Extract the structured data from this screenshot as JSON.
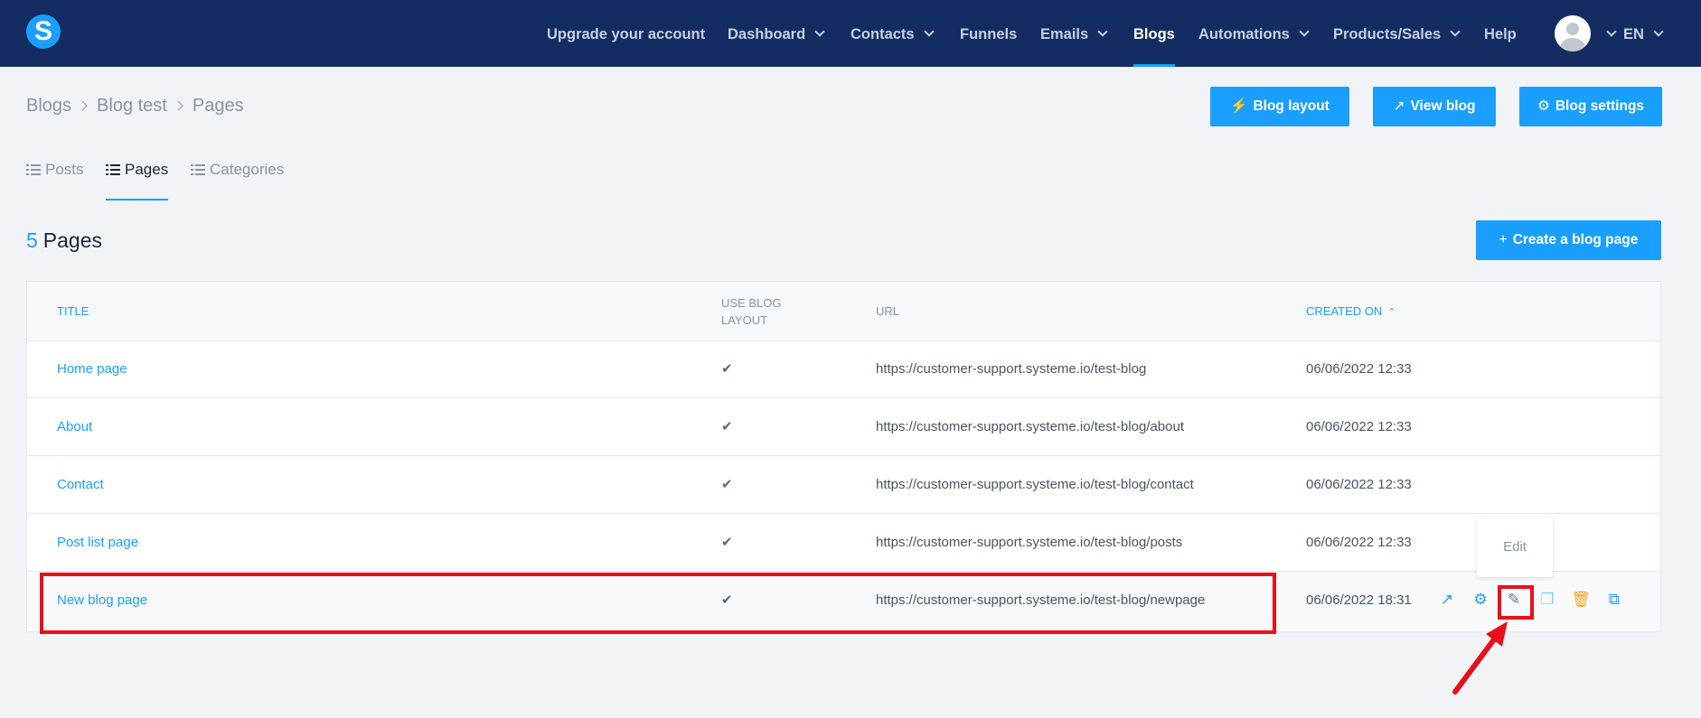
{
  "nav": {
    "items": [
      {
        "label": "Upgrade your account",
        "dropdown": false
      },
      {
        "label": "Dashboard",
        "dropdown": true
      },
      {
        "label": "Contacts",
        "dropdown": true
      },
      {
        "label": "Funnels",
        "dropdown": false
      },
      {
        "label": "Emails",
        "dropdown": true
      },
      {
        "label": "Blogs",
        "dropdown": false,
        "active": true
      },
      {
        "label": "Automations",
        "dropdown": true
      },
      {
        "label": "Products/Sales",
        "dropdown": true
      },
      {
        "label": "Help",
        "dropdown": false
      }
    ],
    "language": "EN",
    "logo_letter": "S"
  },
  "breadcrumb": [
    "Blogs",
    "Blog test",
    "Pages"
  ],
  "actions": {
    "blog_layout": "Blog layout",
    "view_blog": "View blog",
    "blog_settings": "Blog settings"
  },
  "tabs": [
    {
      "label": "Posts"
    },
    {
      "label": "Pages",
      "active": true
    },
    {
      "label": "Categories"
    }
  ],
  "summary": {
    "count": "5",
    "label": "Pages"
  },
  "create_button": "Create a blog page",
  "table": {
    "headers": {
      "title": "Title",
      "use_blog_line1": "Use blog",
      "use_blog_line2": "layout",
      "url": "URL",
      "created_on": "Created on"
    },
    "rows": [
      {
        "title": "Home page",
        "use_layout": "✔",
        "url": "https://customer-support.systeme.io/test-blog",
        "created": "06/06/2022 12:33"
      },
      {
        "title": "About",
        "use_layout": "✔",
        "url": "https://customer-support.systeme.io/test-blog/about",
        "created": "06/06/2022 12:33"
      },
      {
        "title": "Contact",
        "use_layout": "✔",
        "url": "https://customer-support.systeme.io/test-blog/contact",
        "created": "06/06/2022 12:33"
      },
      {
        "title": "Post list page",
        "use_layout": "✔",
        "url": "https://customer-support.systeme.io/test-blog/posts",
        "created": "06/06/2022 12:33"
      },
      {
        "title": "New blog page",
        "use_layout": "✔",
        "url": "https://customer-support.systeme.io/test-blog/newpage",
        "created": "06/06/2022 18:31"
      }
    ]
  },
  "tooltip": "Edit",
  "icons": {
    "nav": "chevron-down-icon",
    "actions": [
      "magic-wand-icon",
      "external-link-icon",
      "gear-icon"
    ],
    "row_actions": [
      "external-link-icon",
      "gear-icon",
      "magic-wand-icon",
      "copy-icon",
      "trash-icon",
      "duplicate-icon"
    ]
  },
  "colors": {
    "navbar": "#132d63",
    "accent": "#1a9fff",
    "highlight": "#e8101a",
    "trash": "#f5a623"
  }
}
